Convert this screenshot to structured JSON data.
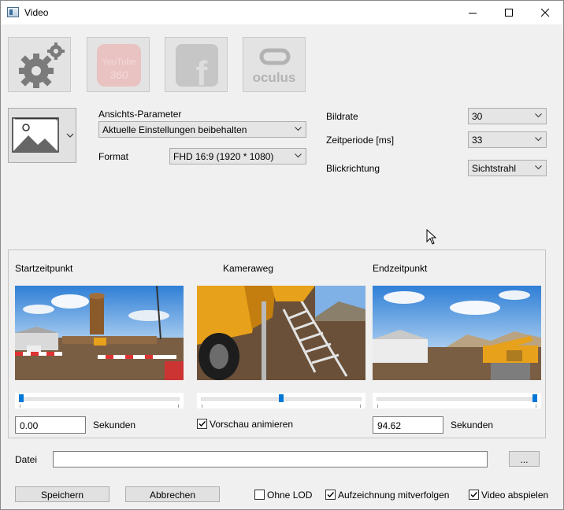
{
  "window": {
    "title": "Video"
  },
  "toolbar": {
    "buttons": [
      {
        "name": "settings",
        "enabled": true
      },
      {
        "name": "youtube-360",
        "enabled": false,
        "logo_text_1": "YouTube",
        "logo_text_2": "360"
      },
      {
        "name": "facebook",
        "enabled": false,
        "logo_text": "f"
      },
      {
        "name": "oculus",
        "enabled": false,
        "logo_text": "oculus"
      }
    ]
  },
  "view": {
    "params_label": "Ansichts-Parameter",
    "params_value": "Aktuelle Einstellungen beibehalten",
    "format_label": "Format",
    "format_value": "FHD 16:9 (1920 * 1080)"
  },
  "right": {
    "framerate_label": "Bildrate",
    "framerate_value": "30",
    "period_label": "Zeitperiode [ms]",
    "period_value": "33",
    "viewdir_label": "Blickrichtung",
    "viewdir_value": "Sichtstrahl"
  },
  "timeline": {
    "start_label": "Startzeitpunkt",
    "path_label": "Kameraweg",
    "end_label": "Endzeitpunkt",
    "start_value": "0.00",
    "end_value": "94.62",
    "seconds_label": "Sekunden",
    "preview_label": "Vorschau animieren",
    "preview_checked": true,
    "start_slider_fraction": 0.0,
    "path_slider_fraction": 0.5,
    "end_slider_fraction": 1.0
  },
  "file": {
    "label": "Datei",
    "value": "",
    "browse_label": "..."
  },
  "footer": {
    "save_label": "Speichern",
    "cancel_label": "Abbrechen",
    "no_lod_label": "Ohne LOD",
    "no_lod_checked": false,
    "follow_label": "Aufzeichnung mitverfolgen",
    "follow_checked": true,
    "play_label": "Video abspielen",
    "play_checked": true
  },
  "colors": {
    "accent": "#0078d7",
    "sky": "#3f8fe0",
    "ground": "#7a5e44",
    "machine": "#e8a11a"
  }
}
